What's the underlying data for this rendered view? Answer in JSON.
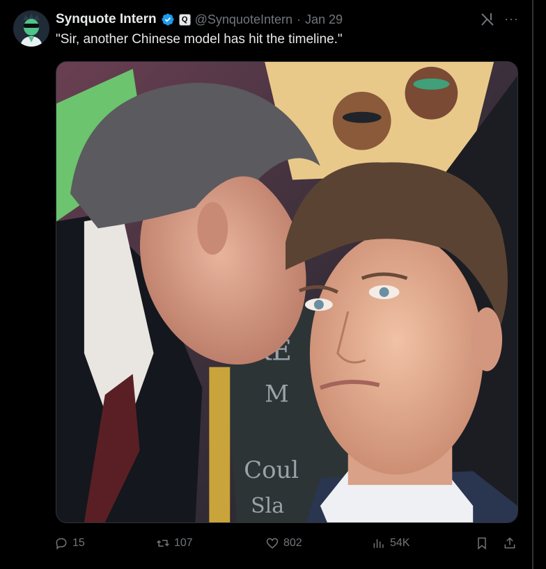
{
  "post": {
    "display_name": "Synquote Intern",
    "affiliation_badge": "Q",
    "handle": "@SynquoteIntern",
    "separator": "·",
    "date": "Jan 29",
    "text": "\"Sir, another Chinese model has hit the timeline.\"",
    "more_label": "···"
  },
  "actions": {
    "replies": "15",
    "reposts": "107",
    "likes": "802",
    "views": "54K"
  },
  "icons": {
    "reply": "reply-icon",
    "repost": "repost-icon",
    "like": "heart-icon",
    "views": "views-icon",
    "bookmark": "bookmark-icon",
    "share": "share-icon",
    "grok": "grok-icon",
    "more": "more-icon",
    "verified": "verified-badge-icon"
  },
  "colors": {
    "background": "#000000",
    "text": "#e7e9ea",
    "muted": "#71767b",
    "verified": "#1d9bf0"
  }
}
